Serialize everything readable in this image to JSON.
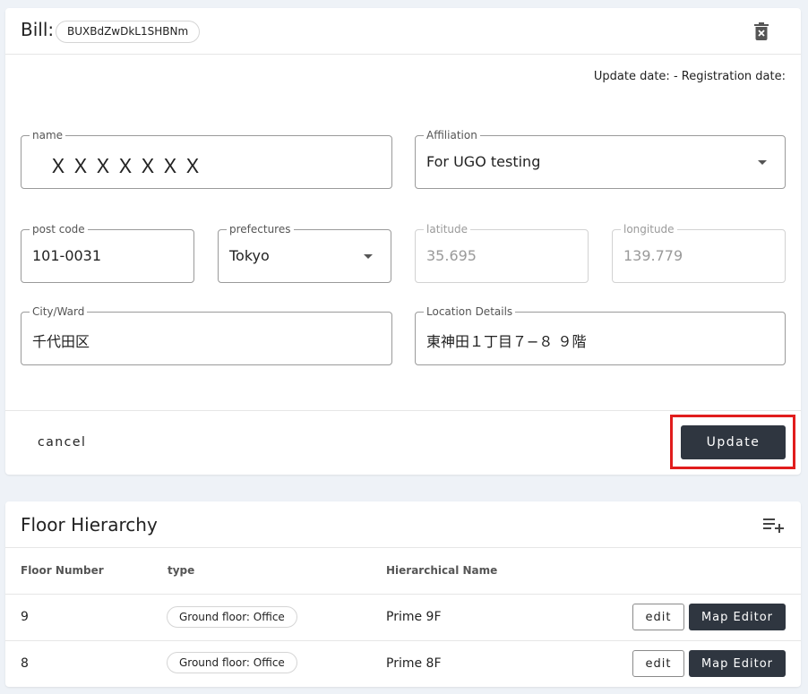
{
  "bill": {
    "title": "Bill:",
    "id": "BUXBdZwDkL1SHBNm",
    "dates": "Update date: - Registration date:",
    "fields": {
      "name": {
        "label": "name",
        "value": "ＸＸＸＸＸＸＸ"
      },
      "affiliation": {
        "label": "Affiliation",
        "value": "For UGO testing"
      },
      "post_code": {
        "label": "post code",
        "value": "101-0031"
      },
      "prefectures": {
        "label": "prefectures",
        "value": "Tokyo"
      },
      "latitude": {
        "label": "latitude",
        "value": "35.695"
      },
      "longitude": {
        "label": "longitude",
        "value": "139.779"
      },
      "city_ward": {
        "label": "City/Ward",
        "value": "千代田区"
      },
      "location_details": {
        "label": "Location Details",
        "value": "東神田１丁目７−８ ９階"
      }
    },
    "cancel_label": "cancel",
    "update_label": "Update",
    "highlight_color": "#e11d1d"
  },
  "floor": {
    "title": "Floor Hierarchy",
    "columns": [
      "Floor Number",
      "type",
      "Hierarchical Name"
    ],
    "rows": [
      {
        "floor_number": "9",
        "type": "Ground floor: Office",
        "name": "Prime 9F",
        "edit": "edit",
        "map_editor": "Map Editor"
      },
      {
        "floor_number": "8",
        "type": "Ground floor: Office",
        "name": "Prime 8F",
        "edit": "edit",
        "map_editor": "Map Editor"
      }
    ]
  },
  "icons": {
    "delete": "trash-icon",
    "add_floor": "playlist-add-icon"
  }
}
